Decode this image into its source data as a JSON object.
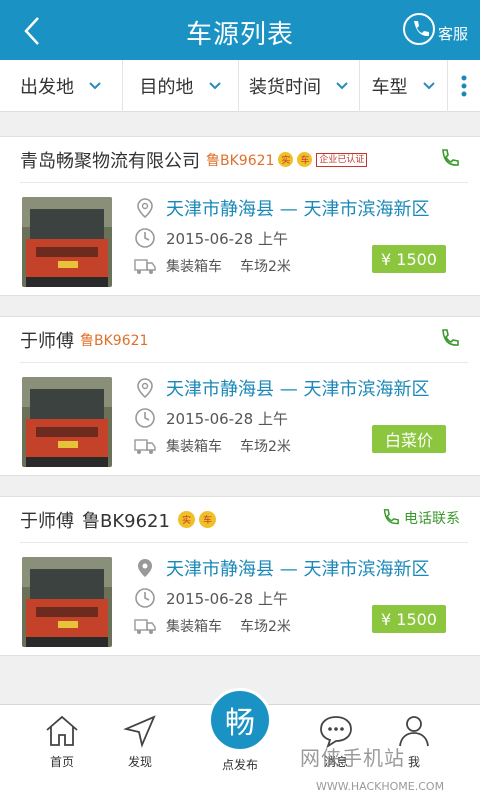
{
  "header": {
    "title": "车源列表",
    "service_label": "客服"
  },
  "filters": [
    "出发地",
    "目的地",
    "装货时间",
    "车型"
  ],
  "listings": [
    {
      "name": "青岛畅聚物流有限公司",
      "plate": "鲁BK9621",
      "badges": [
        "实",
        "车"
      ],
      "cert_label": "企业已认证",
      "phone_label": "",
      "route": "天津市静海县 — 天津市滨海新区",
      "date": "2015-06-28 上午",
      "vehicle_type": "集装箱车",
      "length": "车场2米",
      "price": "¥ 1500"
    },
    {
      "name": "于师傅",
      "plate": "鲁BK9621",
      "badges": [],
      "cert_label": "",
      "phone_label": "",
      "route": "天津市静海县 — 天津市滨海新区",
      "date": "2015-06-28 上午",
      "vehicle_type": "集装箱车",
      "length": "车场2米",
      "price": "白菜价"
    },
    {
      "name": "于师傅",
      "plate": "鲁BK9621",
      "badges": [
        "实",
        "车"
      ],
      "cert_label": "",
      "phone_label": "电话联系",
      "route": "天津市静海县 — 天津市滨海新区",
      "date": "2015-06-28 上午",
      "vehicle_type": "集装箱车",
      "length": "车场2米",
      "price": "¥ 1500"
    }
  ],
  "tabbar": {
    "home": "首页",
    "discover": "发现",
    "publish_glyph": "畅",
    "publish": "点发布",
    "messages": "消息",
    "me": "我"
  },
  "watermark": {
    "text": "网侠手机站",
    "url": "WWW.HACKHOME.COM"
  },
  "colors": {
    "primary": "#1a93c4",
    "price": "#8cc63f",
    "route": "#1a88b8",
    "phone": "#3a9a2c"
  }
}
